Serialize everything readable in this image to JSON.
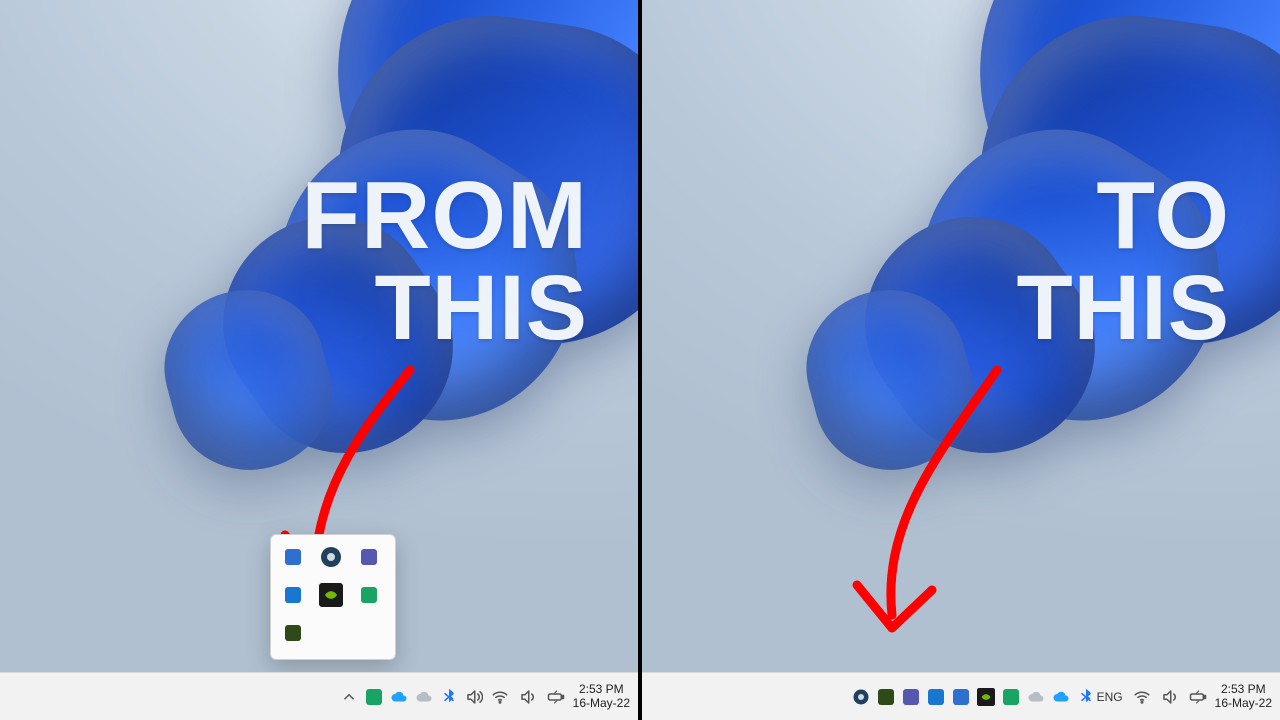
{
  "captions": {
    "left_line1": "FROM",
    "left_line2": "THIS",
    "right_line1": "TO",
    "right_line2": "THIS"
  },
  "popup_icons": [
    {
      "name": "todo-icon",
      "color": "#2f6fd0"
    },
    {
      "name": "bing-icon",
      "color": "#21405e"
    },
    {
      "name": "teams-icon",
      "color": "#5558af"
    },
    {
      "name": "outlook-icon",
      "color": "#1877d1"
    },
    {
      "name": "nvidia-icon",
      "color": "#2e2e2e"
    },
    {
      "name": "k-app-icon",
      "color": "#19a463"
    },
    {
      "name": "idm-icon",
      "color": "#2e4a18"
    }
  ],
  "left_tray": [
    {
      "name": "overflow-chevron-icon",
      "kind": "chev"
    },
    {
      "name": "k-app-icon",
      "kind": "color",
      "color": "#19a463"
    },
    {
      "name": "onedrive-icon",
      "kind": "cloudblue"
    },
    {
      "name": "weather-icon",
      "kind": "cloudgrey"
    },
    {
      "name": "bluetooth-icon",
      "kind": "bt"
    },
    {
      "name": "volume-icon",
      "kind": "vol"
    }
  ],
  "left_sys": [
    {
      "name": "wifi-icon"
    },
    {
      "name": "sound-icon"
    },
    {
      "name": "battery-icon"
    }
  ],
  "right_tray": [
    {
      "name": "bing-icon",
      "kind": "circle",
      "color": "#21405e"
    },
    {
      "name": "idm-icon",
      "kind": "color",
      "color": "#2e4a18"
    },
    {
      "name": "teams-icon",
      "kind": "color",
      "color": "#5558af"
    },
    {
      "name": "outlook-icon",
      "kind": "color",
      "color": "#1877d1"
    },
    {
      "name": "todo-icon",
      "kind": "color",
      "color": "#2f6fd0"
    },
    {
      "name": "nvidia-icon",
      "kind": "nvidia"
    },
    {
      "name": "k-app-icon",
      "kind": "color",
      "color": "#19a463"
    },
    {
      "name": "weather-icon",
      "kind": "cloudgrey"
    },
    {
      "name": "onedrive-icon",
      "kind": "cloudblue"
    },
    {
      "name": "bluetooth-icon",
      "kind": "bt"
    }
  ],
  "right_lang": "ENG",
  "right_sys": [
    {
      "name": "wifi-icon"
    },
    {
      "name": "sound-icon"
    },
    {
      "name": "battery-icon"
    }
  ],
  "clock": {
    "time": "2:53 PM",
    "date": "16-May-22"
  }
}
